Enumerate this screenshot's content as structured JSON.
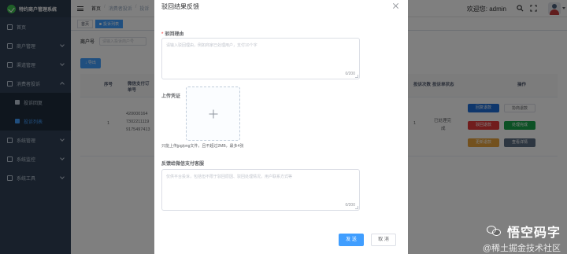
{
  "app": {
    "title": "特约商户管理系统"
  },
  "sidebar": {
    "items": [
      {
        "label": "首页",
        "icon": "home-icon"
      },
      {
        "label": "商户管理",
        "icon": "store-icon"
      },
      {
        "label": "渠道管理",
        "icon": "channel-icon"
      },
      {
        "label": "消费者投诉",
        "icon": "complaint-icon",
        "open": true,
        "children": [
          {
            "label": "投诉回复",
            "icon": "reply-icon"
          },
          {
            "label": "投诉列表",
            "icon": "list-icon",
            "active": true
          }
        ]
      },
      {
        "label": "系统管理",
        "icon": "settings-icon"
      },
      {
        "label": "系统监控",
        "icon": "monitor-icon"
      },
      {
        "label": "系统工具",
        "icon": "tools-icon"
      }
    ]
  },
  "header": {
    "breadcrumb": [
      "首页",
      "消费者投诉",
      "投诉"
    ],
    "welcome": "欢迎您: admin"
  },
  "tags": [
    {
      "label": "首页",
      "active": false
    },
    {
      "label": "投诉列表",
      "active": true
    }
  ],
  "page": {
    "search": {
      "label": "商户号",
      "placeholder": "请输入投诉商户号"
    },
    "export_label": "导出",
    "table": {
      "headers": [
        "序号",
        "微信支付订单号",
        "投诉次数",
        "投诉单状态",
        "操作"
      ],
      "rows": [
        {
          "index": "1",
          "order_no": [
            "420000164",
            "7302211119",
            "9175497413"
          ],
          "count": "1",
          "status": [
            "已处理完",
            "成"
          ]
        }
      ],
      "actions": [
        {
          "label": "回复退款",
          "color": "#1e6fd9"
        },
        {
          "label": "协商退款",
          "color": "#ffffff"
        },
        {
          "label": "驳回退款",
          "color": "#e23b3b"
        },
        {
          "label": "处理完成",
          "color": "#19a34a"
        },
        {
          "label": "更新退款",
          "color": "#e6a23c"
        },
        {
          "label": "查看详情",
          "color": "#5a6d82"
        }
      ]
    }
  },
  "dialog": {
    "title": "驳回结果反馈",
    "reason": {
      "label": "驳回理由",
      "required": true,
      "placeholder": "请输入驳回理由，例如商家已处理用户，支付10个字",
      "counter": "0/200"
    },
    "upload": {
      "label": "上传凭证",
      "tip": "只能上传jpg/png文件，且不超过2MB，最多4张"
    },
    "feedback": {
      "label": "反馈给微信支付客服",
      "placeholder": "仅供平台投诉，包括但不限于驳回原因、驳回处理情况，用户联系方式等",
      "counter": "0/200"
    },
    "confirm_label": "发 送",
    "cancel_label": "取 消"
  },
  "watermark": {
    "title": "悟空码字",
    "subtitle": "@稀土掘金技术社区"
  },
  "colors": {
    "primary": "#409eff",
    "sidebar_bg": "#304156",
    "danger": "#f56c6c"
  }
}
